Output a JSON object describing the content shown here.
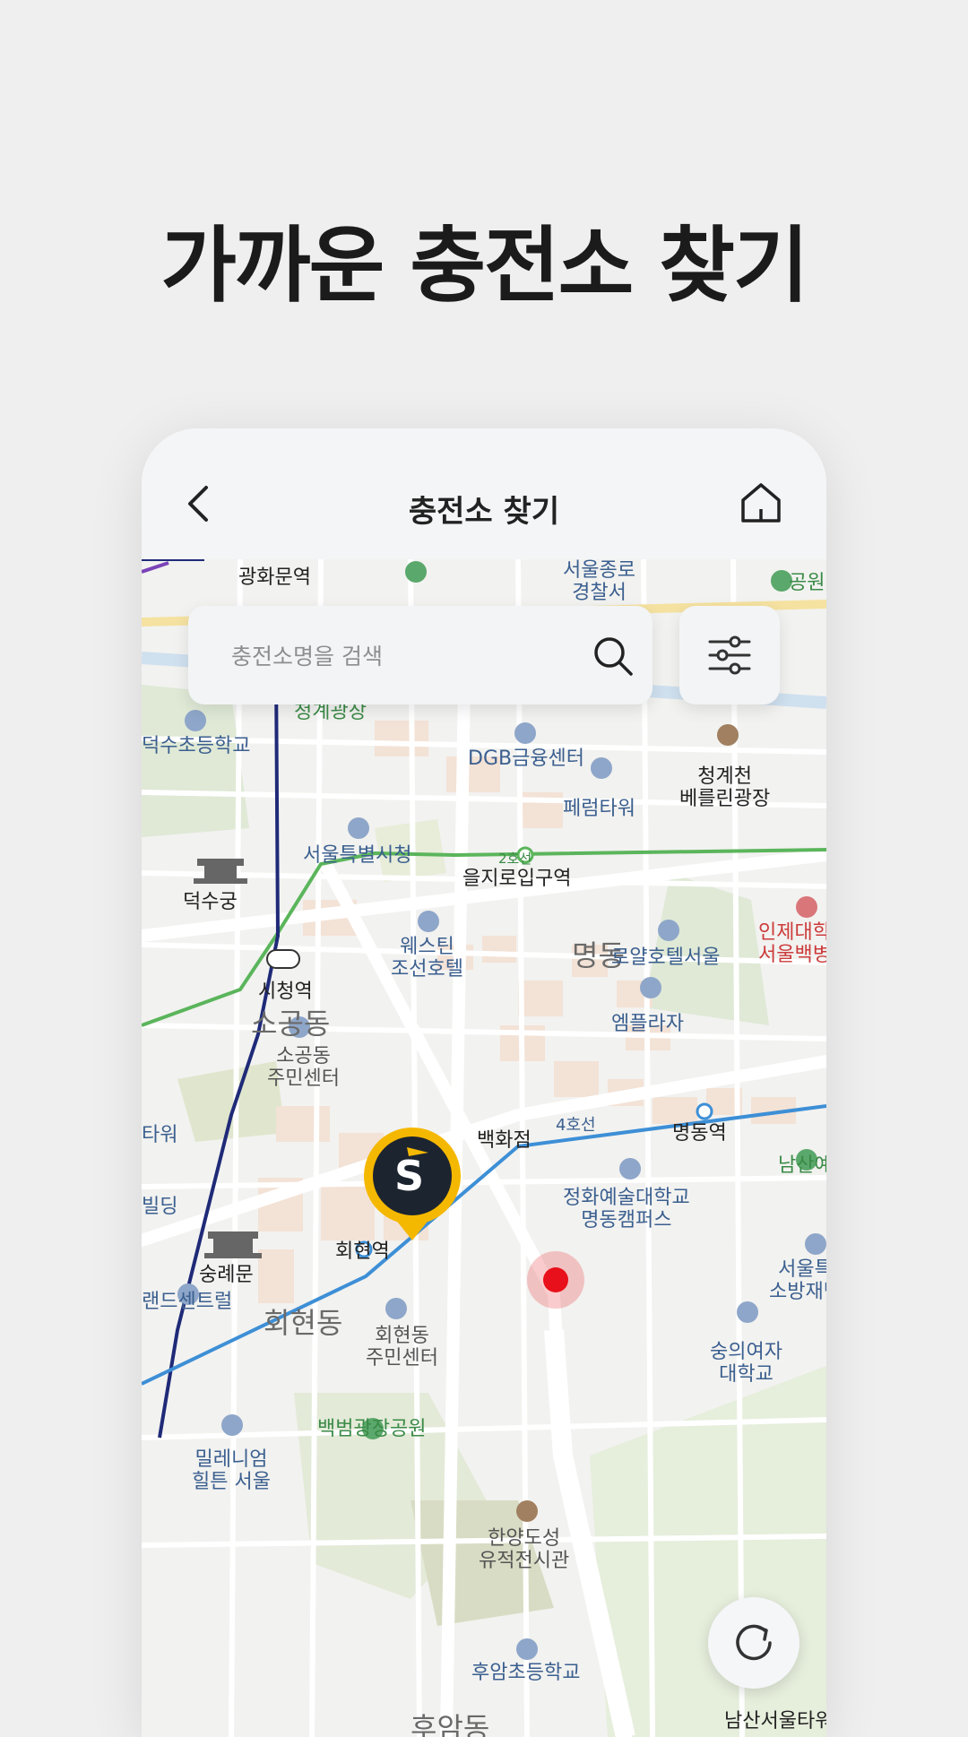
{
  "promo": {
    "headline": "가까운 충전소 찾기"
  },
  "header": {
    "title": "충전소 찾기"
  },
  "search": {
    "placeholder": "충전소명을 검색"
  },
  "colors": {
    "marker_yellow": "#f5b800",
    "marker_dark": "#1c2430",
    "current_location": "#e8101a",
    "line2_green": "#5bb55b",
    "line4_blue": "#3d8fd6",
    "line1_navy": "#1f2a78"
  },
  "map_labels": [
    "광화문역",
    "서울종로\n경찰서",
    "청계광장",
    "덕수초등학교",
    "DGB금융센터",
    "청계천\n베를린광장",
    "페럼타워",
    "서울특별시청",
    "을지로입구역",
    "덕수궁",
    "인제대학\n서울백병",
    "웨스틴\n조선호텔",
    "명동",
    "로얄호텔서울",
    "시청역",
    "소공동",
    "소공동\n주민센터",
    "엠플라자",
    "백화점",
    "4호선",
    "명동역",
    "남산예장",
    "숭례문",
    "정화예술대학교\n명동캠퍼스",
    "회현역",
    "서울특\n소방재난",
    "랜드센트럴",
    "회현동",
    "회현동\n주민센터",
    "숭의여자\n대학교",
    "밀레니엄\n힐튼 서울",
    "백범광장공원",
    "한양도성\n유적전시관",
    "후암초등학교",
    "남산서울타워",
    "2호선",
    "타워",
    "빌딩",
    "공원",
    "후암동"
  ],
  "marker": {
    "brand_letter": "S"
  },
  "icons": [
    "back-arrow-icon",
    "home-icon",
    "search-icon",
    "filter-sliders-icon",
    "refresh-icon"
  ]
}
